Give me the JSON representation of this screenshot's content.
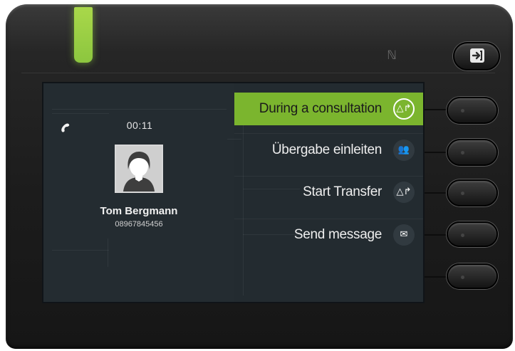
{
  "call": {
    "timer": "00:11",
    "caller_name": "Tom Bergmann",
    "caller_number": "08967845456"
  },
  "menu": {
    "items": [
      {
        "label": "During a consultation",
        "icon": "consult-transfer-icon",
        "active": true
      },
      {
        "label": "Übergabe einleiten",
        "icon": "handover-icon",
        "active": false
      },
      {
        "label": "Start Transfer",
        "icon": "transfer-icon",
        "active": false
      },
      {
        "label": "Send message",
        "icon": "message-icon",
        "active": false
      }
    ]
  },
  "colors": {
    "accent": "#7bb52e",
    "led": "#8cc63f",
    "screen_bg": "#232b30"
  }
}
